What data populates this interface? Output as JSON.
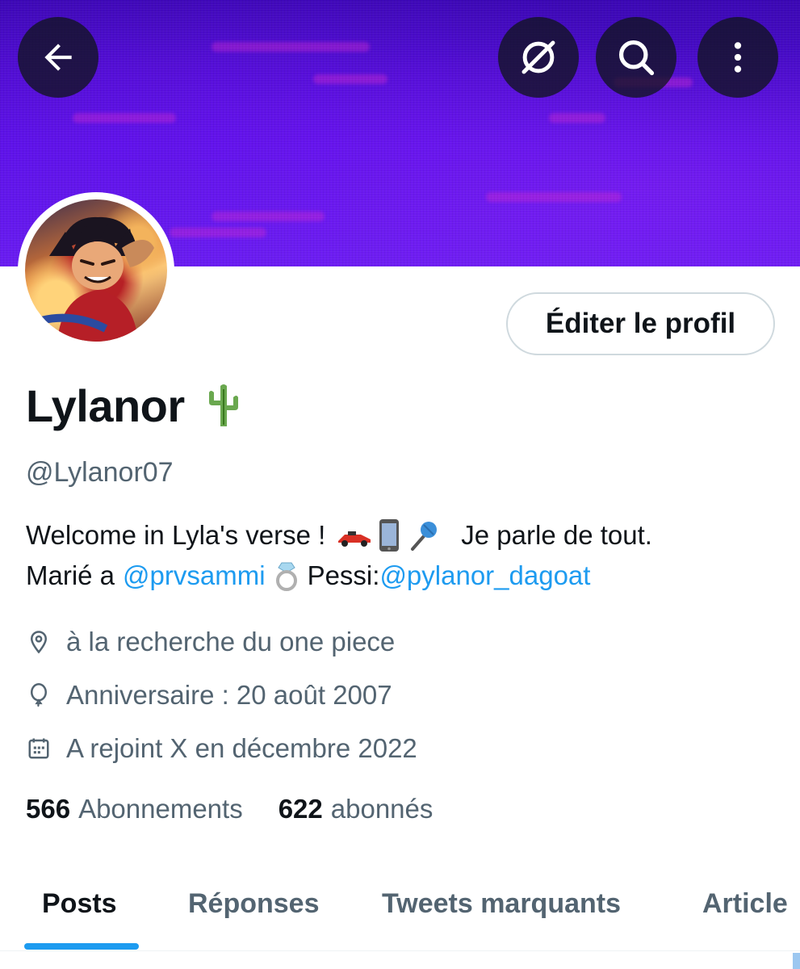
{
  "header": {
    "back_icon": "arrow-left-icon",
    "grok_icon": "slashed-circle-icon",
    "search_icon": "search-icon",
    "more_icon": "more-vertical-icon",
    "banner_color": "#5a12e6"
  },
  "profile": {
    "edit_label": "Éditer le profil",
    "name": "Lylanor",
    "name_emoji": "cactus",
    "handle": "@Lylanor07",
    "bio": {
      "line1_text": "Welcome in Lyla's verse !",
      "line1_emojis": [
        "racing-car",
        "mobile-phone",
        "microphone"
      ],
      "line1_tail": "Je parle de tout.",
      "line2_prefix": "Marié a",
      "line2_mention1": "@prvsammi",
      "line2_emoji": "ring",
      "line2_label": "Pessi:",
      "line2_mention2": "@pylanor_dagoat"
    },
    "location": "à la recherche du one piece",
    "birthday": "Anniversaire : 20 août 2007",
    "joined": "A rejoint X en décembre 2022",
    "following_count": "566",
    "following_label": "Abonnements",
    "followers_count": "622",
    "followers_label": "abonnés"
  },
  "tabs": [
    {
      "label": "Posts",
      "active": true
    },
    {
      "label": "Réponses",
      "active": false
    },
    {
      "label": "Tweets marquants",
      "active": false
    },
    {
      "label": "Article",
      "active": false
    }
  ],
  "colors": {
    "accent": "#1d9bf0",
    "secondary_text": "#536471",
    "primary_text": "#0f1419"
  }
}
